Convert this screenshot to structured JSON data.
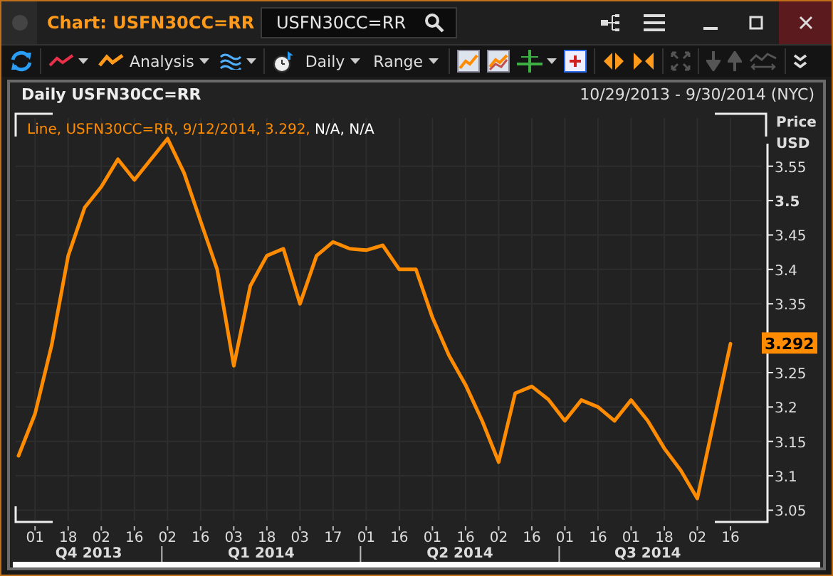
{
  "window": {
    "title": "Chart: USFN30CC=RR",
    "search": {
      "value": "USFN30CC=RR"
    }
  },
  "toolbar": {
    "menus": [
      {
        "label": "Analysis"
      },
      {
        "label": "Daily"
      },
      {
        "label": "Range"
      }
    ]
  },
  "chart": {
    "title": "Daily USFN30CC=RR",
    "date_range": "10/29/2013 - 9/30/2014 (NYC)",
    "legend": {
      "series_text": "Line, USFN30CC=RR, 9/12/2014, 3.292,",
      "extra_text": "N/A, N/A"
    },
    "axis_title": [
      "Price",
      "USD"
    ],
    "last_value": "3.292",
    "quarters": [
      {
        "label": "Q4 2013"
      },
      {
        "label": "Q1 2014"
      },
      {
        "label": "Q2 2014"
      },
      {
        "label": "Q3 2014"
      }
    ],
    "chart_data": {
      "type": "line",
      "grid": true,
      "ylim": [
        3.035,
        3.62
      ],
      "categories": [
        null,
        "01",
        null,
        "18",
        null,
        "02",
        null,
        "16",
        null,
        "02",
        null,
        "16",
        null,
        "03",
        null,
        "18",
        null,
        "03",
        null,
        "17",
        null,
        "01",
        null,
        "16",
        null,
        "01",
        null,
        "16",
        null,
        "02",
        null,
        "16",
        null,
        "01",
        null,
        "16",
        null,
        "01",
        null,
        "18",
        null,
        "02",
        null,
        "16"
      ],
      "series": [
        {
          "color": "#ff8c00",
          "values": [
            3.129,
            3.19,
            3.29,
            3.42,
            3.49,
            3.52,
            3.56,
            3.53,
            3.56,
            3.59,
            3.54,
            3.47,
            3.4,
            3.26,
            3.376,
            3.42,
            3.43,
            3.35,
            3.42,
            3.44,
            3.43,
            3.428,
            3.435,
            3.4,
            3.4,
            3.33,
            3.275,
            3.232,
            3.18,
            3.12,
            3.22,
            3.23,
            3.211,
            3.18,
            3.21,
            3.2,
            3.18,
            3.21,
            3.18,
            3.14,
            3.108,
            3.067,
            3.18,
            3.292
          ]
        }
      ],
      "yticks": [
        3.05,
        3.1,
        3.15,
        3.2,
        3.25,
        3.35,
        3.4,
        3.45,
        3.5,
        3.55
      ]
    }
  }
}
